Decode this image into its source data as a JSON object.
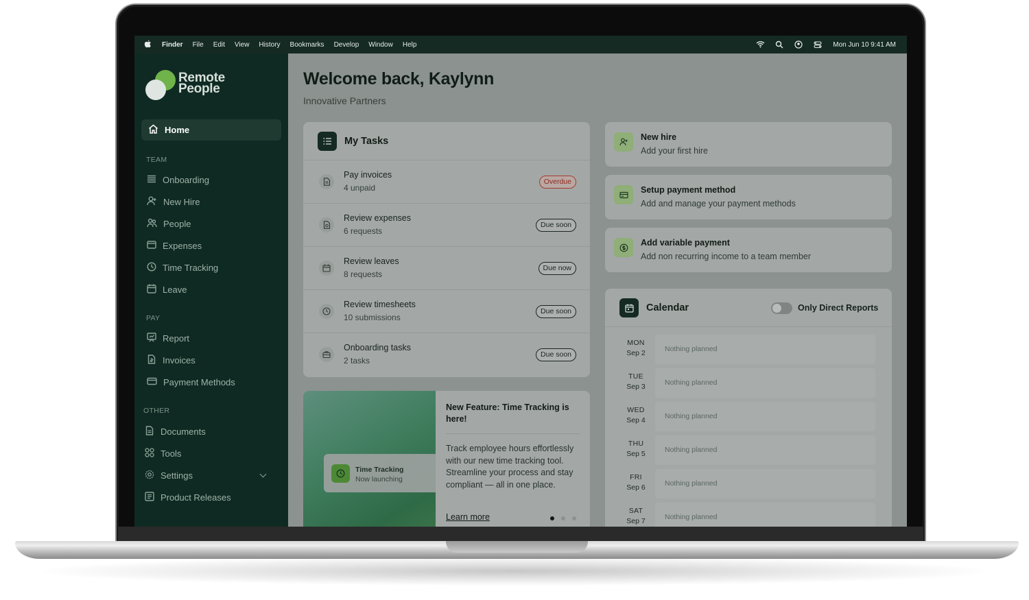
{
  "menubar": {
    "items": [
      "Finder",
      "File",
      "Edit",
      "View",
      "History",
      "Bookmarks",
      "Develop",
      "Window",
      "Help"
    ],
    "datetime": "Mon Jun 10  9:41 AM"
  },
  "sidebar": {
    "brand_line1": "Remote",
    "brand_line2": "People",
    "home": "Home",
    "sections": {
      "team": "TEAM",
      "pay": "PAY",
      "other": "OTHER"
    },
    "team_items": [
      "Onboarding",
      "New Hire",
      "People",
      "Expenses",
      "Time Tracking",
      "Leave"
    ],
    "pay_items": [
      "Report",
      "Invoices",
      "Payment Methods"
    ],
    "other_items": [
      "Documents",
      "Tools",
      "Settings",
      "Product Releases"
    ]
  },
  "header": {
    "welcome": "Welcome back, Kaylynn",
    "company": "Innovative Partners"
  },
  "tasks": {
    "title": "My Tasks",
    "items": [
      {
        "name": "Pay invoices",
        "sub": "4 unpaid",
        "badge": "Overdue"
      },
      {
        "name": "Review expenses",
        "sub": "6 requests",
        "badge": "Due soon"
      },
      {
        "name": "Review leaves",
        "sub": "8 requests",
        "badge": "Due now"
      },
      {
        "name": "Review timesheets",
        "sub": "10 submissions",
        "badge": "Due soon"
      },
      {
        "name": "Onboarding tasks",
        "sub": "2 tasks",
        "badge": "Due soon"
      }
    ]
  },
  "promo": {
    "tile_title": "Time Tracking",
    "tile_sub": "Now launching",
    "title": "New Feature: Time Tracking is here!",
    "body": "Track employee hours effortlessly with our new time tracking tool. Streamline your process and stay compliant — all in one place.",
    "link": "Learn more",
    "slide_count": 3,
    "active_slide": 1
  },
  "actions": [
    {
      "title": "New hire",
      "sub": "Add your first hire",
      "icon": "add-person-icon"
    },
    {
      "title": "Setup payment method",
      "sub": "Add and manage your payment methods",
      "icon": "card-icon"
    },
    {
      "title": "Add variable payment",
      "sub": "Add non recurring income to a team member",
      "icon": "dollar-icon"
    }
  ],
  "calendar": {
    "title": "Calendar",
    "toggle_label": "Only Direct Reports",
    "toggle_on": false,
    "days": [
      {
        "day": "MON",
        "date": "Sep 2",
        "text": "Nothing planned"
      },
      {
        "day": "TUE",
        "date": "Sep 3",
        "text": "Nothing planned"
      },
      {
        "day": "WED",
        "date": "Sep 4",
        "text": "Nothing planned"
      },
      {
        "day": "THU",
        "date": "Sep 5",
        "text": "Nothing planned"
      },
      {
        "day": "FRI",
        "date": "Sep 6",
        "text": "Nothing planned"
      },
      {
        "day": "SAT",
        "date": "Sep 7",
        "text": "Nothing planned"
      }
    ]
  },
  "colors": {
    "sidebar_bg": "#0f2a22",
    "accent_green": "#6fb34a",
    "overdue": "#a33b2e"
  }
}
